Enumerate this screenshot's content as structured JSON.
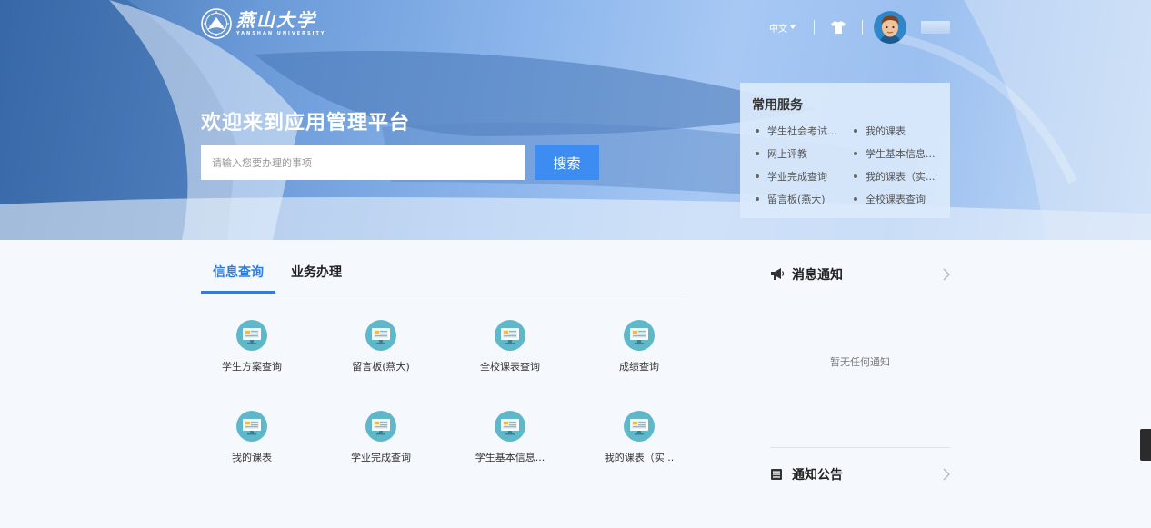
{
  "header": {
    "logo_cn": "燕山大学",
    "logo_en": "YANSHAN UNIVERSITY",
    "lang_label": "中文"
  },
  "hero": {
    "welcome": "欢迎来到应用管理平台",
    "search_placeholder": "请输入您要办理的事项",
    "search_button": "搜索"
  },
  "services": {
    "title": "常用服务",
    "items": [
      "学生社会考试...",
      "我的课表",
      "网上评教",
      "学生基本信息...",
      "学业完成查询",
      "我的课表（实...",
      "留言板(燕大)",
      "全校课表查询"
    ]
  },
  "tabs": [
    {
      "label": "信息查询",
      "active": true
    },
    {
      "label": "业务办理",
      "active": false
    }
  ],
  "apps": [
    "学生方案查询",
    "留言板(燕大)",
    "全校课表查询",
    "成绩查询",
    "我的课表",
    "学业完成查询",
    "学生基本信息...",
    "我的课表（实..."
  ],
  "notices": {
    "title": "消息通知",
    "empty": "暂无任何通知"
  },
  "bulletins": {
    "title": "通知公告"
  },
  "colors": {
    "accent": "#2f7de1",
    "search_button": "#3d8cf2",
    "app_icon_bg": "#5fb8c9"
  }
}
